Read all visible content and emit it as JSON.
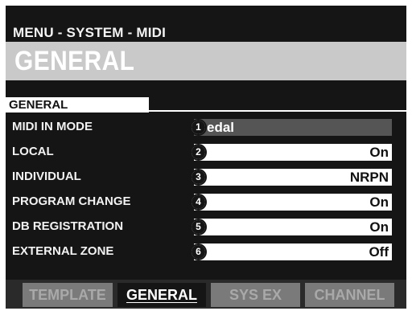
{
  "header": {
    "breadcrumb": "MENU - SYSTEM - MIDI",
    "title": "GENERAL"
  },
  "section": {
    "label": "GENERAL"
  },
  "rows": [
    {
      "label": "MIDI IN MODE",
      "value": "edal",
      "marker": "1"
    },
    {
      "label": "LOCAL",
      "value": "On",
      "marker": "2"
    },
    {
      "label": "INDIVIDUAL",
      "value": "NRPN",
      "marker": "3"
    },
    {
      "label": "PROGRAM CHANGE",
      "value": "On",
      "marker": "4"
    },
    {
      "label": "DB REGISTRATION",
      "value": "On",
      "marker": "5"
    },
    {
      "label": "EXTERNAL ZONE",
      "value": "Off",
      "marker": "6"
    }
  ],
  "tabs": [
    {
      "label": "TEMPLATE"
    },
    {
      "label": "GENERAL"
    },
    {
      "label": "SYS EX"
    },
    {
      "label": "CHANNEL"
    }
  ]
}
